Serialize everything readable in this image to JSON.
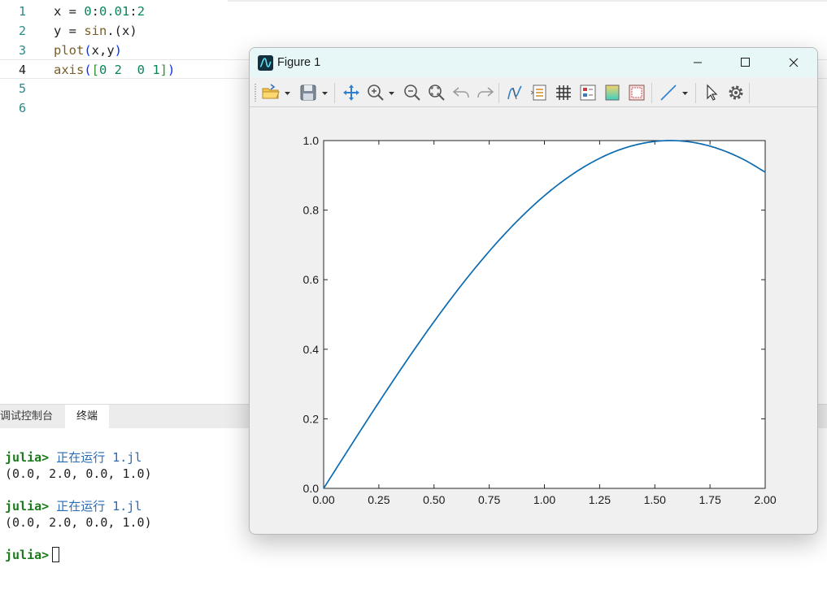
{
  "editor": {
    "lines": [
      {
        "number": "1",
        "tokens": [
          {
            "t": "x = ",
            "c": "tk-var"
          },
          {
            "t": "0",
            "c": "tk-num"
          },
          {
            "t": ":",
            "c": "tk-var"
          },
          {
            "t": "0.01",
            "c": "tk-num"
          },
          {
            "t": ":",
            "c": "tk-var"
          },
          {
            "t": "2",
            "c": "tk-num"
          }
        ]
      },
      {
        "number": "2",
        "tokens": [
          {
            "t": "y = ",
            "c": "tk-var"
          },
          {
            "t": "sin",
            "c": "tk-fn"
          },
          {
            "t": ".(",
            "c": "tk-var"
          },
          {
            "t": "x",
            "c": "tk-var"
          },
          {
            "t": ")",
            "c": "tk-var"
          }
        ]
      },
      {
        "number": "3",
        "tokens": [
          {
            "t": "plot",
            "c": "tk-fn"
          },
          {
            "t": "(",
            "c": "tk-br"
          },
          {
            "t": "x,y",
            "c": "tk-var"
          },
          {
            "t": ")",
            "c": "tk-br"
          }
        ]
      },
      {
        "number": "4",
        "tokens": [
          {
            "t": "axis",
            "c": "tk-fn"
          },
          {
            "t": "(",
            "c": "tk-br"
          },
          {
            "t": "[",
            "c": "tk-br2"
          },
          {
            "t": "0 2  0 1",
            "c": "tk-num"
          },
          {
            "t": "]",
            "c": "tk-br2"
          },
          {
            "t": ")",
            "c": "tk-br"
          }
        ]
      },
      {
        "number": "5",
        "tokens": []
      },
      {
        "number": "6",
        "tokens": []
      }
    ],
    "active_line": 4
  },
  "panel": {
    "tabs": [
      "调试控制台",
      "终端"
    ],
    "active_tab": "终端",
    "terminal": [
      {
        "prompt": "julia>",
        "text": " 正在运行 1.jl"
      },
      {
        "prompt": "",
        "text": "(0.0, 2.0, 0.0, 1.0)"
      },
      {
        "prompt": "",
        "text": ""
      },
      {
        "prompt": "julia>",
        "text": " 正在运行 1.jl"
      },
      {
        "prompt": "",
        "text": "(0.0, 2.0, 0.0, 1.0)"
      },
      {
        "prompt": "",
        "text": ""
      },
      {
        "prompt": "julia>",
        "text": ""
      }
    ]
  },
  "figure": {
    "title": "Figure 1",
    "toolbar_icons": [
      "open-file-icon",
      "save-icon",
      "pan-icon",
      "zoom-in-icon",
      "zoom-out-icon",
      "zoom-fit-icon",
      "undo-icon",
      "redo-icon",
      "data-cursor-icon",
      "legend-icon",
      "grid-icon",
      "colorbar-icon",
      "color-icon",
      "box-icon",
      "line-icon",
      "select-arrow-icon",
      "settings-gear-icon"
    ],
    "line_color": "#0b6ab0",
    "accent": "#e7f6f6"
  },
  "chart_data": {
    "type": "line",
    "title": "",
    "xlabel": "",
    "ylabel": "",
    "xlim": [
      0,
      2
    ],
    "ylim": [
      0,
      1
    ],
    "xticks": [
      "0.00",
      "0.25",
      "0.50",
      "0.75",
      "1.00",
      "1.25",
      "1.50",
      "1.75",
      "2.00"
    ],
    "yticks": [
      "0.0",
      "0.2",
      "0.4",
      "0.6",
      "0.8",
      "1.0"
    ],
    "grid": false,
    "series": [
      {
        "x": [
          0,
          0.1,
          0.2,
          0.3,
          0.4,
          0.5,
          0.6,
          0.7,
          0.8,
          0.9,
          1.0,
          1.1,
          1.2,
          1.3,
          1.4,
          1.5,
          1.6,
          1.7,
          1.8,
          1.9,
          2.0
        ],
        "values": [
          0,
          0.0998,
          0.1987,
          0.2955,
          0.3894,
          0.4794,
          0.5646,
          0.6442,
          0.7174,
          0.7833,
          0.8415,
          0.8912,
          0.932,
          0.9636,
          0.9854,
          0.9975,
          0.9996,
          0.9917,
          0.9738,
          0.9463,
          0.9093
        ]
      }
    ]
  }
}
